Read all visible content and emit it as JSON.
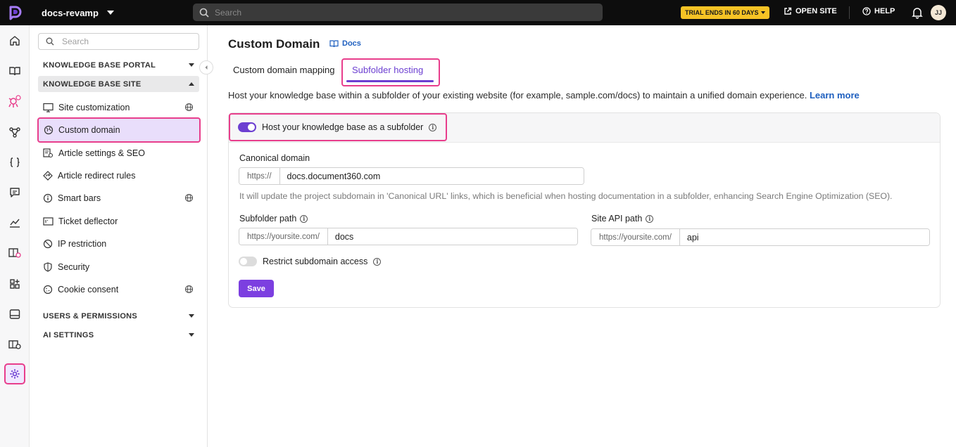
{
  "topbar": {
    "project_name": "docs-revamp",
    "search_placeholder": "Search",
    "trial_label": "TRIAL ENDS IN 60 DAYS",
    "open_site_label": "OPEN SITE",
    "help_label": "HELP",
    "avatar_initials": "JJ"
  },
  "rail": {
    "icons": [
      "home-icon",
      "book-icon",
      "bug-icon",
      "workflow-icon",
      "braces-icon",
      "comment-icon",
      "analytics-icon",
      "book-settings-icon",
      "apps-icon",
      "widget-icon",
      "pages-settings-icon",
      "settings-icon"
    ],
    "active": "settings-icon"
  },
  "sidebar": {
    "search_placeholder": "Search",
    "sections": {
      "portal": "KNOWLEDGE BASE PORTAL",
      "site": "KNOWLEDGE BASE SITE",
      "users": "USERS & PERMISSIONS",
      "ai": "AI SETTINGS"
    },
    "items": [
      {
        "label": "Site customization",
        "globe": true
      },
      {
        "label": "Custom domain",
        "globe": false,
        "active": true
      },
      {
        "label": "Article settings & SEO",
        "globe": false
      },
      {
        "label": "Article redirect rules",
        "globe": false
      },
      {
        "label": "Smart bars",
        "globe": true
      },
      {
        "label": "Ticket deflector",
        "globe": false
      },
      {
        "label": "IP restriction",
        "globe": false
      },
      {
        "label": "Security",
        "globe": false
      },
      {
        "label": "Cookie consent",
        "globe": true
      }
    ]
  },
  "main": {
    "title": "Custom Domain",
    "docs_link": "Docs",
    "tabs": [
      {
        "label": "Custom domain mapping",
        "active": false
      },
      {
        "label": "Subfolder hosting",
        "active": true
      }
    ],
    "description": "Host your knowledge base within a subfolder of your existing website (for example, sample.com/docs) to maintain a unified domain experience.",
    "learn_more": "Learn more",
    "host_toggle_label": "Host your knowledge base as a subfolder",
    "host_toggle_on": true,
    "canonical": {
      "label": "Canonical domain",
      "prefix": "https://",
      "value": "docs.document360.com",
      "hint": "It will update the project subdomain in 'Canonical URL' links, which is beneficial when hosting documentation in a subfolder, enhancing Search Engine Optimization (SEO)."
    },
    "subfolder": {
      "label": "Subfolder path",
      "prefix": "https://yoursite.com/",
      "value": "docs"
    },
    "site_api": {
      "label": "Site API path",
      "prefix": "https://yoursite.com/",
      "value": "api"
    },
    "restrict_label": "Restrict subdomain access",
    "restrict_on": false,
    "save_label": "Save"
  },
  "colors": {
    "accent": "#6c3fd1",
    "highlight": "#e83e8c",
    "link": "#1e5fbf",
    "trial": "#f6c325"
  }
}
